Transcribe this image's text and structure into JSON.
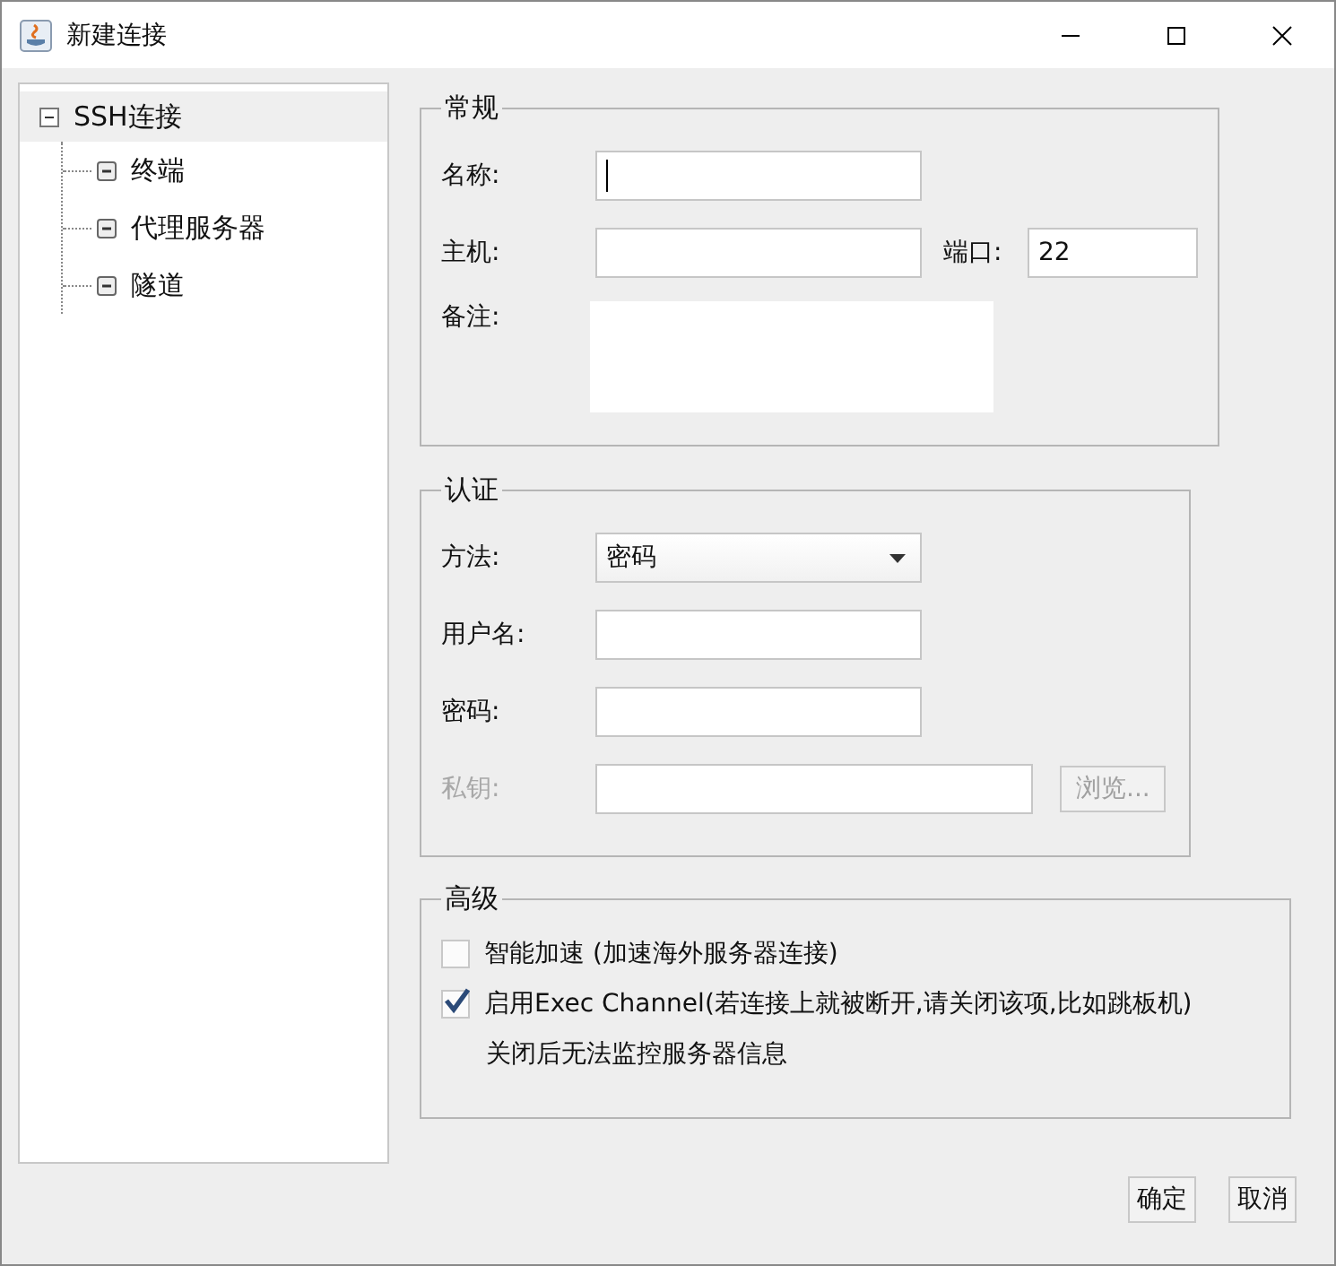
{
  "window": {
    "title": "新建连接"
  },
  "tree": [
    {
      "label": "SSH连接",
      "selected": true,
      "children": [
        {
          "label": "终端",
          "selected": false
        },
        {
          "label": "代理服务器",
          "selected": false
        },
        {
          "label": "隧道",
          "selected": false
        }
      ]
    }
  ],
  "general": {
    "title": "常规",
    "name": {
      "label": "名称:",
      "focused": true
    },
    "host": {
      "label": "主机:"
    },
    "port": {
      "label": "端口:",
      "value": "22"
    },
    "note": {
      "label": "备注:"
    }
  },
  "auth": {
    "title": "认证",
    "method": {
      "label": "方法:",
      "value": "密码"
    },
    "username": {
      "label": "用户名:"
    },
    "password": {
      "label": "密码:"
    },
    "key": {
      "label": "私钥:",
      "disabled": true,
      "button": "浏览..."
    }
  },
  "advanced": {
    "title": "高级",
    "options": [
      {
        "label": "智能加速 (加速海外服务器连接)",
        "checked": false
      },
      {
        "label": "启用Exec Channel(若连接上就被断开,请关闭该项,比如跳板机)",
        "checked": true
      }
    ],
    "note": "关闭后无法监控服务器信息"
  },
  "buttons": [
    "确定",
    "取消"
  ]
}
